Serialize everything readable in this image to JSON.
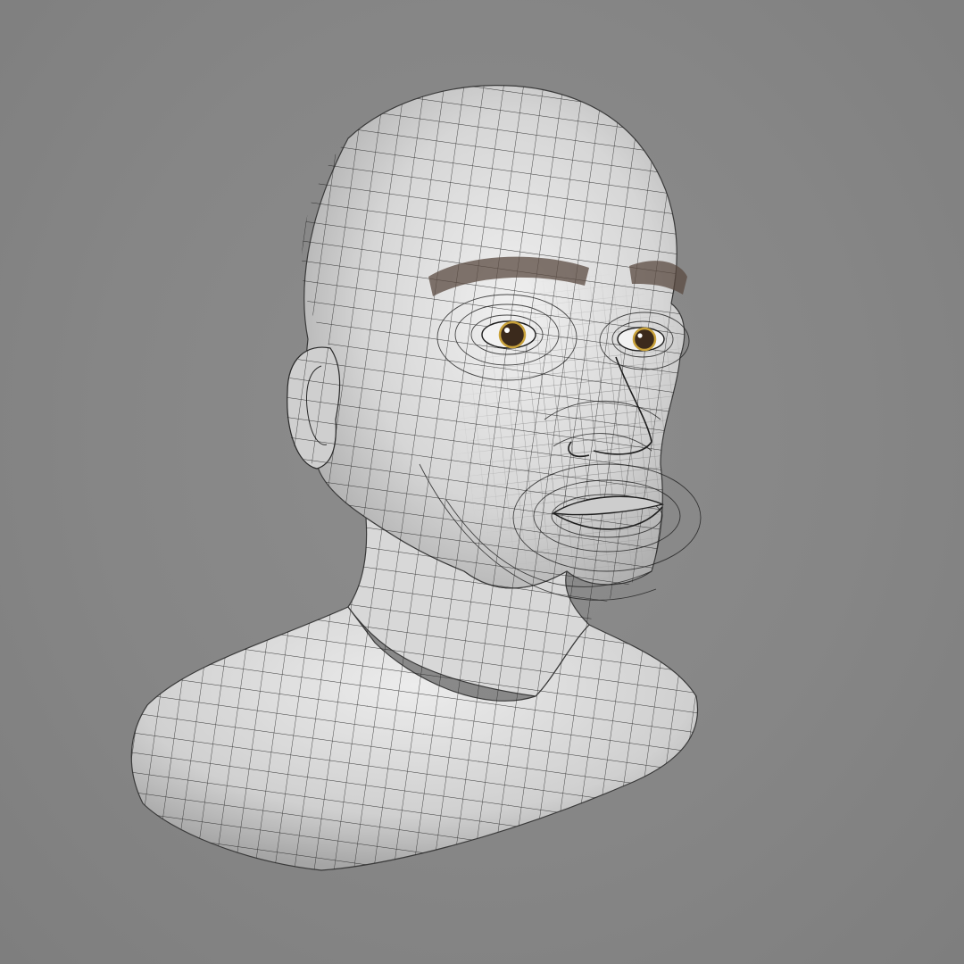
{
  "scene": {
    "background_color": "#878787",
    "surface_color": "#dcdcdc",
    "wire_color": "#1e1e1e",
    "iris_color": "#3b2a1c",
    "eye_rim_color": "#c9a23a"
  }
}
